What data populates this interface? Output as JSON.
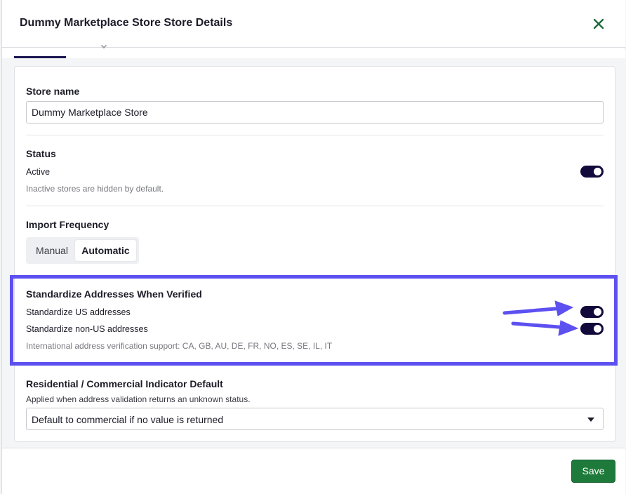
{
  "header": {
    "title": "Dummy Marketplace Store Store Details",
    "close_icon": "close-icon"
  },
  "store_name": {
    "label": "Store name",
    "value": "Dummy Marketplace Store"
  },
  "status": {
    "heading": "Status",
    "toggle_label": "Active",
    "toggle_on": true,
    "hint": "Inactive stores are hidden by default."
  },
  "import_frequency": {
    "heading": "Import Frequency",
    "options": [
      "Manual",
      "Automatic"
    ],
    "selected": "Automatic"
  },
  "standardize": {
    "heading": "Standardize Addresses When Verified",
    "us_label": "Standardize US addresses",
    "us_on": true,
    "non_us_label": "Standardize non-US addresses",
    "non_us_on": true,
    "hint": "International address verification support: CA, GB, AU, DE, FR, NO, ES, SE, IL, IT"
  },
  "residential": {
    "heading": "Residential / Commercial Indicator Default",
    "hint": "Applied when address validation returns an unknown status.",
    "selected": "Default to commercial if no value is returned"
  },
  "footer": {
    "save_label": "Save"
  },
  "colors": {
    "accent": "#120a3a",
    "highlight": "#5d50f0",
    "save": "#1e7a3a",
    "close": "#1e6b3a"
  }
}
